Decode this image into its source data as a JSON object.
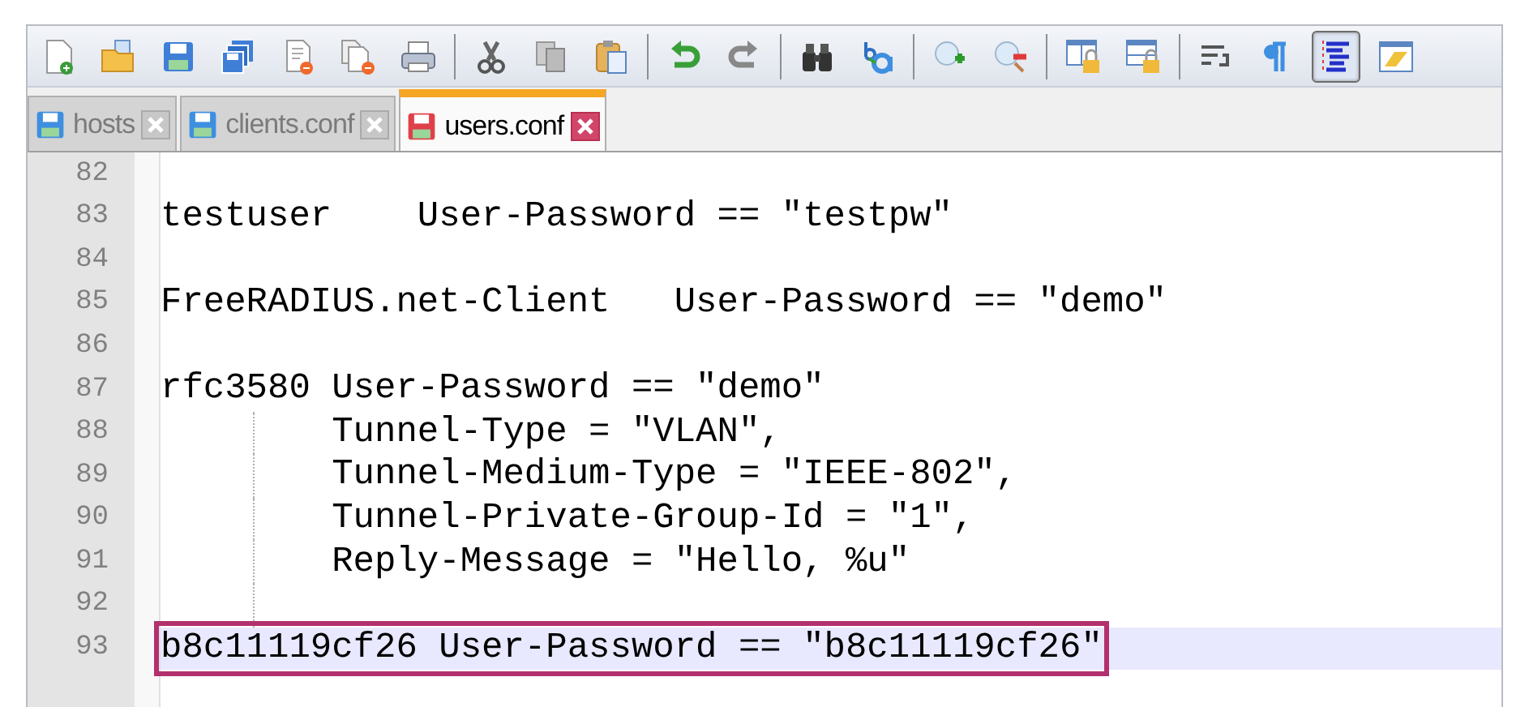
{
  "toolbar": [
    {
      "kind": "new",
      "pressed": false
    },
    {
      "kind": "open",
      "pressed": false
    },
    {
      "kind": "save",
      "pressed": false
    },
    {
      "kind": "save-all",
      "pressed": false
    },
    {
      "kind": "close",
      "pressed": false
    },
    {
      "kind": "close-all",
      "pressed": false
    },
    {
      "kind": "print",
      "pressed": false
    },
    {
      "kind": "separator"
    },
    {
      "kind": "cut",
      "pressed": false
    },
    {
      "kind": "copy",
      "pressed": false
    },
    {
      "kind": "paste",
      "pressed": false
    },
    {
      "kind": "separator"
    },
    {
      "kind": "undo",
      "pressed": false
    },
    {
      "kind": "redo",
      "pressed": false
    },
    {
      "kind": "separator"
    },
    {
      "kind": "find",
      "pressed": false
    },
    {
      "kind": "replace",
      "pressed": false
    },
    {
      "kind": "separator"
    },
    {
      "kind": "zoom-in",
      "pressed": false
    },
    {
      "kind": "zoom-out",
      "pressed": false
    },
    {
      "kind": "separator"
    },
    {
      "kind": "sync-v",
      "pressed": false
    },
    {
      "kind": "sync-h",
      "pressed": false
    },
    {
      "kind": "separator"
    },
    {
      "kind": "wrap",
      "pressed": false
    },
    {
      "kind": "pilcrow",
      "pressed": false
    },
    {
      "kind": "indent-guide",
      "pressed": true
    },
    {
      "kind": "panel",
      "pressed": false
    }
  ],
  "tabs": [
    {
      "label": "hosts",
      "selected": false,
      "modified": false
    },
    {
      "label": "clients.conf",
      "selected": false,
      "modified": false
    },
    {
      "label": "users.conf",
      "selected": true,
      "modified": true
    }
  ],
  "lines": [
    {
      "number": "82",
      "current": false,
      "indent_guide": false
    },
    {
      "number": "83",
      "text": "testuser    User-Password == \"testpw\"",
      "current": false,
      "indent_guide": false,
      "highlighted": false
    },
    {
      "number": "84",
      "current": false,
      "indent_guide": false
    },
    {
      "number": "85",
      "text": "FreeRADIUS.net-Client   User-Password == \"demo\"",
      "current": false,
      "indent_guide": false,
      "highlighted": false
    },
    {
      "number": "86",
      "current": false,
      "indent_guide": false
    },
    {
      "number": "87",
      "text": "rfc3580 User-Password == \"demo\"",
      "current": false,
      "indent_guide": false,
      "highlighted": false
    },
    {
      "number": "88",
      "text": "Tunnel-Type = \"VLAN\",",
      "current": false,
      "indent_guide": true,
      "highlighted": false
    },
    {
      "number": "89",
      "text": "Tunnel-Medium-Type = \"IEEE-802\",",
      "current": false,
      "indent_guide": true,
      "highlighted": false
    },
    {
      "number": "90",
      "text": "Tunnel-Private-Group-Id = \"1\",",
      "current": false,
      "indent_guide": true,
      "highlighted": false
    },
    {
      "number": "91",
      "text": "Reply-Message = \"Hello, %u\"",
      "current": false,
      "indent_guide": true,
      "highlighted": false
    },
    {
      "number": "92",
      "current": false,
      "indent_guide": true
    },
    {
      "number": "93",
      "text": "b8c11119cf26 User-Password == \"b8c11119cf26\"",
      "current": true,
      "indent_guide": false,
      "highlighted": true
    }
  ]
}
